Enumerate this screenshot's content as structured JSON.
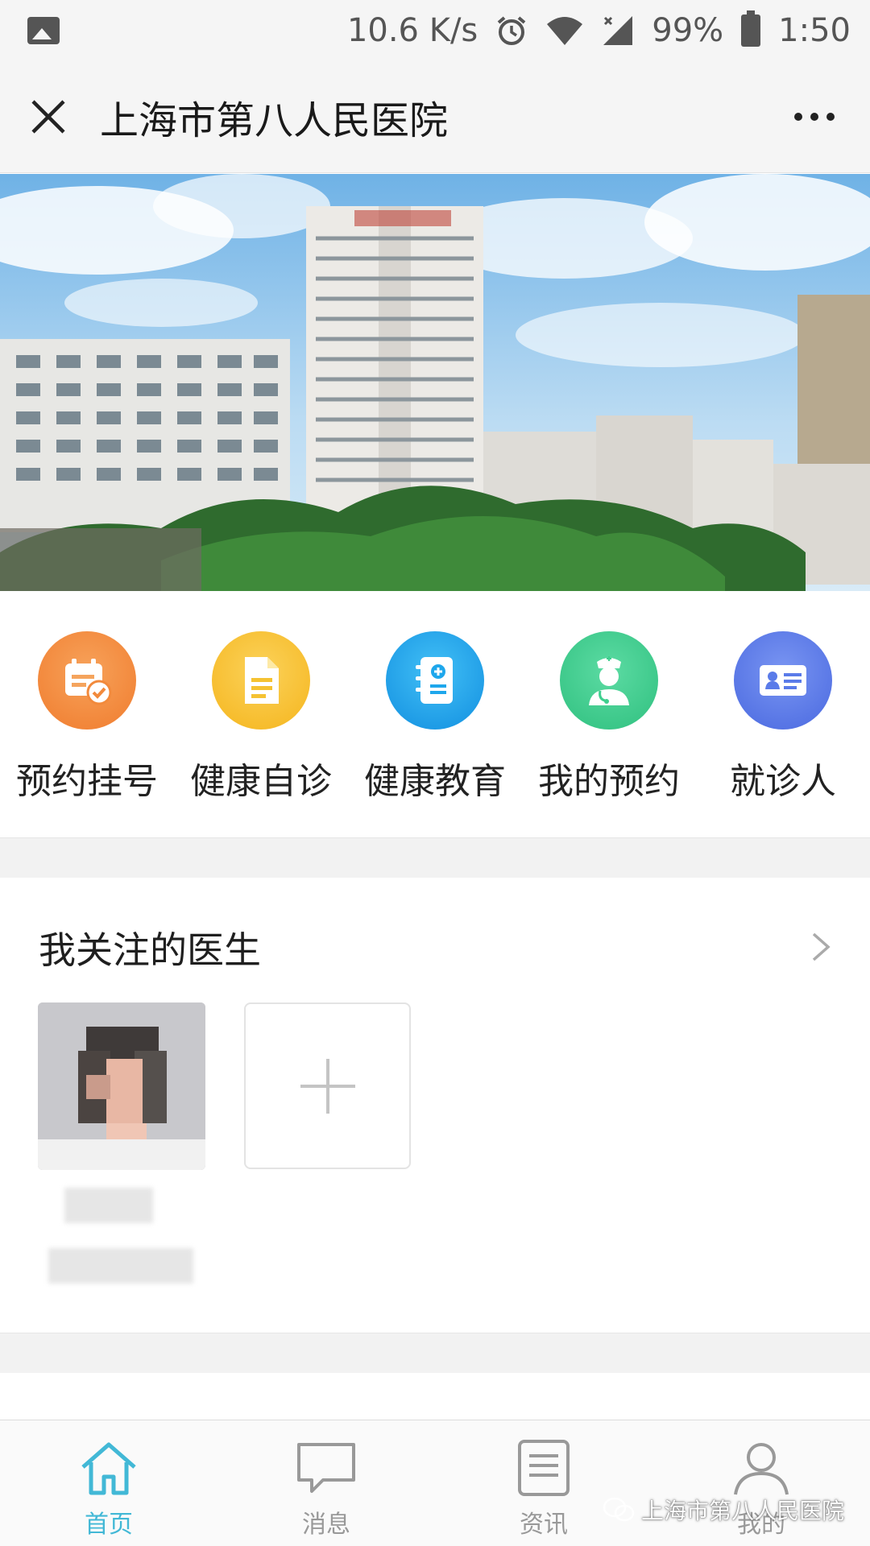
{
  "status_bar": {
    "speed": "10.6 K/s",
    "battery": "99%",
    "time": "1:50"
  },
  "header": {
    "title": "上海市第八人民医院"
  },
  "quick_actions": [
    {
      "label": "预约挂号",
      "icon": "calendar-check-icon",
      "color": "#f28a3c"
    },
    {
      "label": "健康自诊",
      "icon": "document-icon",
      "color": "#f7c432"
    },
    {
      "label": "健康教育",
      "icon": "medical-book-icon",
      "color": "#1ea7ec"
    },
    {
      "label": "我的预约",
      "icon": "doctor-icon",
      "color": "#3fcf8e"
    },
    {
      "label": "就诊人",
      "icon": "id-card-icon",
      "color": "#5a7be9"
    }
  ],
  "followed_doctors": {
    "title": "我关注的医生"
  },
  "tabs": [
    {
      "label": "首页",
      "icon": "home-icon",
      "active": true
    },
    {
      "label": "消息",
      "icon": "message-icon",
      "active": false
    },
    {
      "label": "资讯",
      "icon": "news-icon",
      "active": false
    },
    {
      "label": "我的",
      "icon": "user-icon",
      "active": false
    }
  ],
  "watermark": "上海市第八人民医院",
  "colors": {
    "accent": "#42b8d6",
    "background": "#f5f5f5"
  }
}
